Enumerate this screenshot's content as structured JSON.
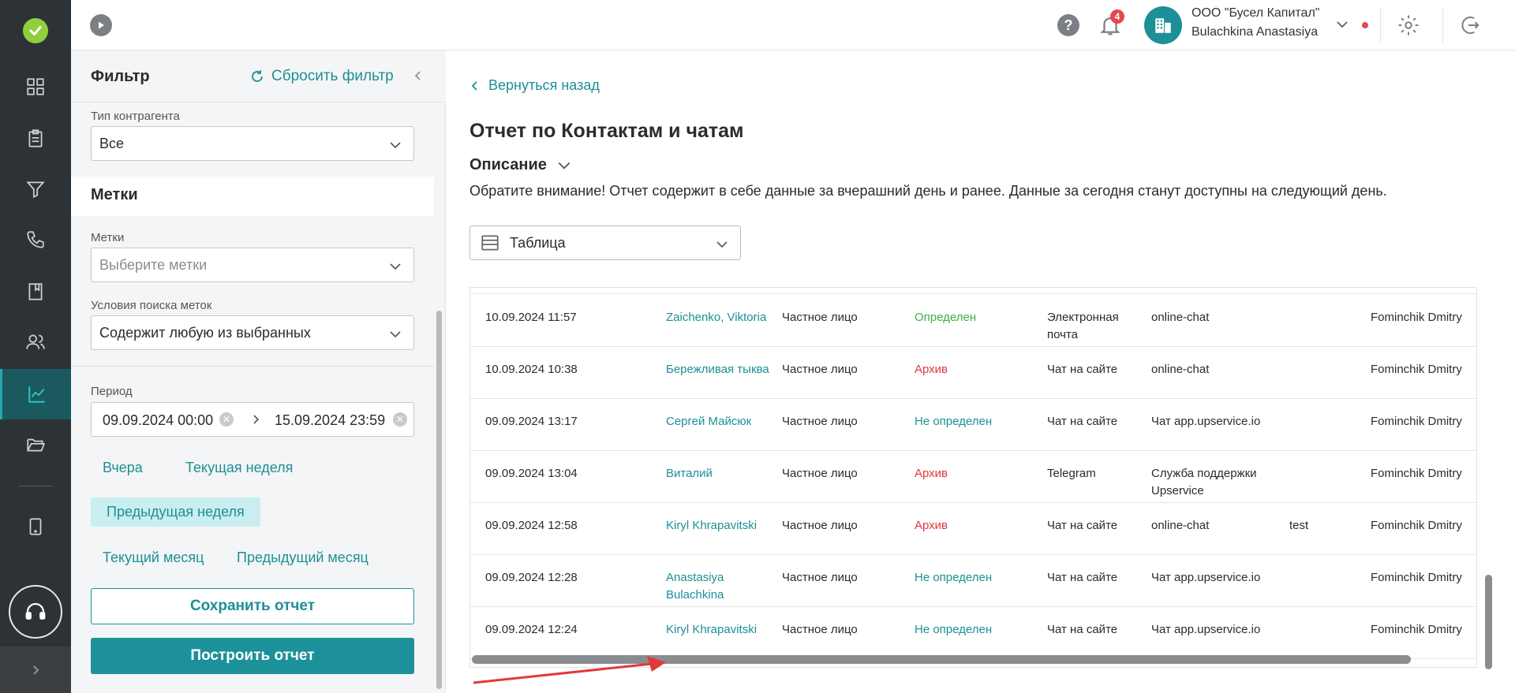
{
  "colors": {
    "accent": "#1d8f96",
    "status_defined": "#3bb04a",
    "status_archive": "#e0383e",
    "status_undefined": "#1d8f96",
    "rail_bg": "#2d3236",
    "badge": "#e5484d"
  },
  "sidebar": {
    "items": [
      {
        "name": "dashboard",
        "icon": "grid-icon"
      },
      {
        "name": "documents",
        "icon": "clipboard-icon"
      },
      {
        "name": "funnel",
        "icon": "funnel-icon"
      },
      {
        "name": "calls",
        "icon": "phone-icon"
      },
      {
        "name": "bookmarks",
        "icon": "book-icon"
      },
      {
        "name": "contacts",
        "icon": "users-icon"
      },
      {
        "name": "reports",
        "icon": "chart-icon",
        "active": true
      },
      {
        "name": "folders",
        "icon": "folder-icon"
      },
      {
        "name": "mobile",
        "icon": "tablet-icon"
      }
    ]
  },
  "header": {
    "notifications_count": "4",
    "company": "ООО \"Бусел Капитал\"",
    "user": "Bulachkina Anastasiya"
  },
  "filter": {
    "title": "Фильтр",
    "reset_label": "Сбросить фильтр",
    "contractor_type_label": "Тип контрагента",
    "contractor_type_value": "Все",
    "tags_section": "Метки",
    "tags_label": "Метки",
    "tags_placeholder": "Выберите метки",
    "tag_condition_label": "Условия поиска меток",
    "tag_condition_value": "Содержит любую из выбранных",
    "period_label": "Период",
    "period_from": "09.09.2024 00:00",
    "period_to": "15.09.2024 23:59",
    "quick": {
      "yesterday": "Вчера",
      "this_week": "Текущая неделя",
      "prev_week": "Предыдущая неделя",
      "this_month": "Текущий месяц",
      "prev_month": "Предыдущий месяц"
    },
    "save_label": "Сохранить отчет",
    "build_label": "Построить отчет"
  },
  "main": {
    "back_label": "Вернуться назад",
    "title": "Отчет по Контактам и чатам",
    "description_label": "Описание",
    "notice": "Обратите внимание! Отчет содержит в себе данные за вчерашний день и ранее. Данные за сегодня станут доступны на следующий день.",
    "view_value": "Таблица"
  },
  "table": {
    "rows": [
      {
        "date": "10.09.2024 11:57",
        "name": "Zaichenko, Viktoria",
        "type": "Частное лицо",
        "status": "Определен",
        "status_kind": "def",
        "channel": "Электронная почта",
        "source": "online-chat",
        "tag": "",
        "responsible": "Fominchik Dmitry"
      },
      {
        "date": "10.09.2024 10:38",
        "name": "Бережливая тыква",
        "type": "Частное лицо",
        "status": "Архив",
        "status_kind": "arch",
        "channel": "Чат на сайте",
        "source": "online-chat",
        "tag": "",
        "responsible": "Fominchik Dmitry"
      },
      {
        "date": "09.09.2024 13:17",
        "name": "Сергей Майсюк",
        "type": "Частное лицо",
        "status": "Не определен",
        "status_kind": "undef",
        "channel": "Чат на сайте",
        "source": "Чат app.upservice.io",
        "tag": "",
        "responsible": "Fominchik Dmitry"
      },
      {
        "date": "09.09.2024 13:04",
        "name": "Виталий",
        "type": "Частное лицо",
        "status": "Архив",
        "status_kind": "arch",
        "channel": "Telegram",
        "source": "Служба поддержки Upservice",
        "tag": "",
        "responsible": "Fominchik Dmitry"
      },
      {
        "date": "09.09.2024 12:58",
        "name": "Kiryl Khrapavitski",
        "type": "Частное лицо",
        "status": "Архив",
        "status_kind": "arch",
        "channel": "Чат на сайте",
        "source": "online-chat",
        "tag": "test",
        "responsible": "Fominchik Dmitry"
      },
      {
        "date": "09.09.2024 12:28",
        "name": "Anastasiya Bulachkina",
        "type": "Частное лицо",
        "status": "Не определен",
        "status_kind": "undef",
        "channel": "Чат на сайте",
        "source": "Чат app.upservice.io",
        "tag": "",
        "responsible": "Fominchik Dmitry"
      },
      {
        "date": "09.09.2024 12:24",
        "name": "Kiryl Khrapavitski",
        "type": "Частное лицо",
        "status": "Не определен",
        "status_kind": "undef",
        "channel": "Чат на сайте",
        "source": "Чат app.upservice.io",
        "tag": "",
        "responsible": "Fominchik Dmitry"
      }
    ]
  }
}
